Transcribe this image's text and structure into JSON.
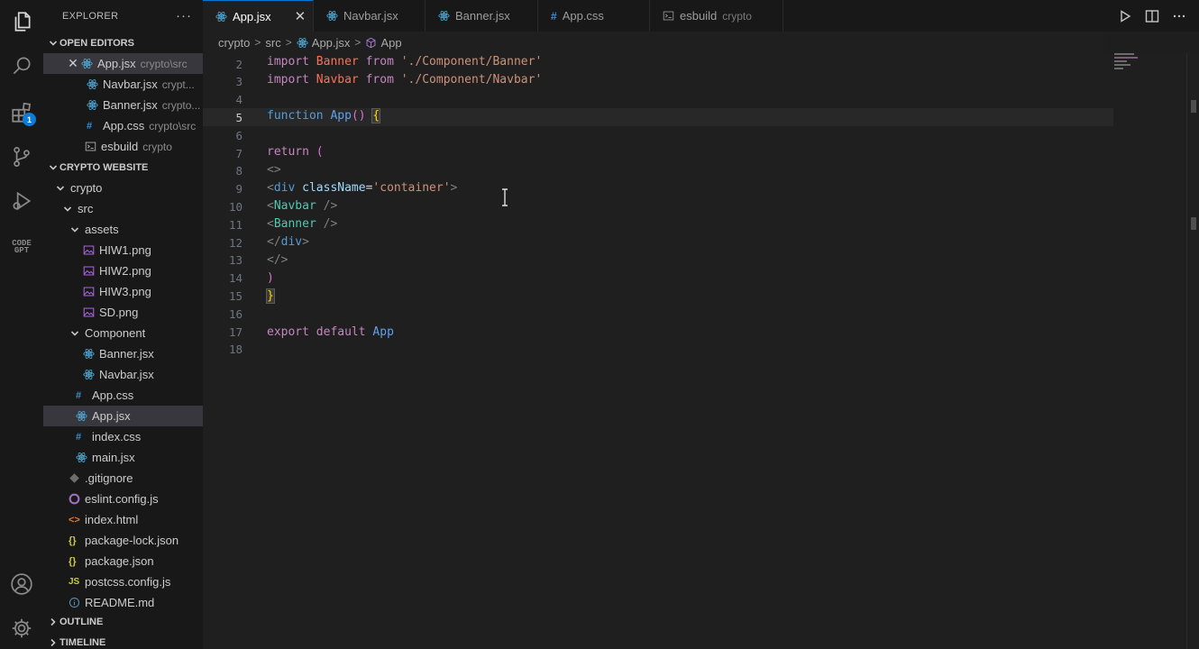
{
  "explorer": {
    "title": "EXPLORER",
    "more": "···",
    "open_editors_label": "OPEN EDITORS",
    "project_label": "CRYPTO WEBSITE",
    "outline_label": "OUTLINE",
    "timeline_label": "TIMELINE",
    "open_editors": [
      {
        "name": "App.jsx",
        "desc": "crypto\\src",
        "icon": "react-icon"
      },
      {
        "name": "Navbar.jsx",
        "desc": "crypt...",
        "icon": "react-icon"
      },
      {
        "name": "Banner.jsx",
        "desc": "crypto...",
        "icon": "react-icon"
      },
      {
        "name": "App.css",
        "desc": "crypto\\src",
        "icon": "css-hash-icon"
      },
      {
        "name": "esbuild",
        "desc": "crypto",
        "icon": "terminal-icon"
      }
    ],
    "tree": [
      {
        "name": "crypto",
        "type": "folder"
      },
      {
        "name": "src",
        "type": "folder"
      },
      {
        "name": "assets",
        "type": "folder"
      },
      {
        "name": "HIW1.png",
        "type": "image"
      },
      {
        "name": "HIW2.png",
        "type": "image"
      },
      {
        "name": "HIW3.png",
        "type": "image"
      },
      {
        "name": "SD.png",
        "type": "image"
      },
      {
        "name": "Component",
        "type": "folder"
      },
      {
        "name": "Banner.jsx",
        "type": "react"
      },
      {
        "name": "Navbar.jsx",
        "type": "react"
      },
      {
        "name": "App.css",
        "type": "css"
      },
      {
        "name": "App.jsx",
        "type": "react"
      },
      {
        "name": "index.css",
        "type": "css"
      },
      {
        "name": "main.jsx",
        "type": "react"
      },
      {
        "name": ".gitignore",
        "type": "git"
      },
      {
        "name": "eslint.config.js",
        "type": "eslint"
      },
      {
        "name": "index.html",
        "type": "html"
      },
      {
        "name": "package-lock.json",
        "type": "json"
      },
      {
        "name": "package.json",
        "type": "json"
      },
      {
        "name": "postcss.config.js",
        "type": "js"
      },
      {
        "name": "README.md",
        "type": "info"
      }
    ]
  },
  "activity": {
    "extensions_badge": "1",
    "codegpt_line1": "CODE",
    "codegpt_line2": "GPT"
  },
  "tabs": [
    {
      "label": "App.jsx",
      "desc": "",
      "icon": "react-icon",
      "active": true,
      "close": "✕"
    },
    {
      "label": "Navbar.jsx",
      "desc": "",
      "icon": "react-icon",
      "active": false
    },
    {
      "label": "Banner.jsx",
      "desc": "",
      "icon": "react-icon",
      "active": false
    },
    {
      "label": "App.css",
      "desc": "",
      "icon": "css-hash-icon",
      "active": false
    },
    {
      "label": "esbuild",
      "desc": "crypto",
      "icon": "terminal-icon",
      "active": false
    }
  ],
  "breadcrumb": {
    "parts": [
      "crypto",
      "src",
      "App.jsx",
      "App"
    ],
    "sep": ">"
  },
  "editor": {
    "line_numbers": [
      "2",
      "3",
      "4",
      "5",
      "6",
      "7",
      "8",
      "9",
      "10",
      "11",
      "12",
      "13",
      "14",
      "15",
      "16",
      "17",
      "18"
    ],
    "current_line": "5",
    "tokens": {
      "import": "import",
      "from": "from",
      "banner": "Banner",
      "navbar": "Navbar",
      "banner_path": "'./Component/Banner'",
      "navbar_path": "'./Component/Navbar'",
      "function": "function",
      "app": "App",
      "parens": "()",
      "open_brace": "{",
      "close_brace": "}",
      "return": "return",
      "open_paren": "(",
      "close_paren": ")",
      "frag_open": "<>",
      "frag_close": "</>",
      "div_open_lt": "<",
      "div": "div",
      "className": "className",
      "eq": "=",
      "container": "'container'",
      "gt": ">",
      "div_close_lt": "</",
      "self_close": " />",
      "export": "export",
      "default": "default"
    }
  },
  "colors": {
    "accent": "#0078d4",
    "react": "#4fa9d6",
    "css": "#3a8fd6",
    "image": "#b267e6",
    "json": "#cbcb41",
    "js": "#cbcb41",
    "html": "#e37933",
    "git": "#6d6d6d",
    "eslint": "#a074c4",
    "info": "#519aba"
  }
}
